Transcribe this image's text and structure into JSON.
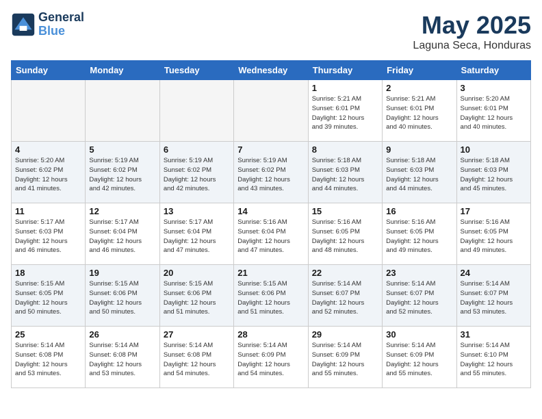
{
  "header": {
    "logo_line1": "General",
    "logo_line2": "Blue",
    "month": "May 2025",
    "location": "Laguna Seca, Honduras"
  },
  "weekdays": [
    "Sunday",
    "Monday",
    "Tuesday",
    "Wednesday",
    "Thursday",
    "Friday",
    "Saturday"
  ],
  "weeks": [
    [
      {
        "day": "",
        "info": "",
        "empty": true
      },
      {
        "day": "",
        "info": "",
        "empty": true
      },
      {
        "day": "",
        "info": "",
        "empty": true
      },
      {
        "day": "",
        "info": "",
        "empty": true
      },
      {
        "day": "1",
        "info": "Sunrise: 5:21 AM\nSunset: 6:01 PM\nDaylight: 12 hours\nand 39 minutes."
      },
      {
        "day": "2",
        "info": "Sunrise: 5:21 AM\nSunset: 6:01 PM\nDaylight: 12 hours\nand 40 minutes."
      },
      {
        "day": "3",
        "info": "Sunrise: 5:20 AM\nSunset: 6:01 PM\nDaylight: 12 hours\nand 40 minutes."
      }
    ],
    [
      {
        "day": "4",
        "info": "Sunrise: 5:20 AM\nSunset: 6:02 PM\nDaylight: 12 hours\nand 41 minutes."
      },
      {
        "day": "5",
        "info": "Sunrise: 5:19 AM\nSunset: 6:02 PM\nDaylight: 12 hours\nand 42 minutes."
      },
      {
        "day": "6",
        "info": "Sunrise: 5:19 AM\nSunset: 6:02 PM\nDaylight: 12 hours\nand 42 minutes."
      },
      {
        "day": "7",
        "info": "Sunrise: 5:19 AM\nSunset: 6:02 PM\nDaylight: 12 hours\nand 43 minutes."
      },
      {
        "day": "8",
        "info": "Sunrise: 5:18 AM\nSunset: 6:03 PM\nDaylight: 12 hours\nand 44 minutes."
      },
      {
        "day": "9",
        "info": "Sunrise: 5:18 AM\nSunset: 6:03 PM\nDaylight: 12 hours\nand 44 minutes."
      },
      {
        "day": "10",
        "info": "Sunrise: 5:18 AM\nSunset: 6:03 PM\nDaylight: 12 hours\nand 45 minutes."
      }
    ],
    [
      {
        "day": "11",
        "info": "Sunrise: 5:17 AM\nSunset: 6:03 PM\nDaylight: 12 hours\nand 46 minutes."
      },
      {
        "day": "12",
        "info": "Sunrise: 5:17 AM\nSunset: 6:04 PM\nDaylight: 12 hours\nand 46 minutes."
      },
      {
        "day": "13",
        "info": "Sunrise: 5:17 AM\nSunset: 6:04 PM\nDaylight: 12 hours\nand 47 minutes."
      },
      {
        "day": "14",
        "info": "Sunrise: 5:16 AM\nSunset: 6:04 PM\nDaylight: 12 hours\nand 47 minutes."
      },
      {
        "day": "15",
        "info": "Sunrise: 5:16 AM\nSunset: 6:05 PM\nDaylight: 12 hours\nand 48 minutes."
      },
      {
        "day": "16",
        "info": "Sunrise: 5:16 AM\nSunset: 6:05 PM\nDaylight: 12 hours\nand 49 minutes."
      },
      {
        "day": "17",
        "info": "Sunrise: 5:16 AM\nSunset: 6:05 PM\nDaylight: 12 hours\nand 49 minutes."
      }
    ],
    [
      {
        "day": "18",
        "info": "Sunrise: 5:15 AM\nSunset: 6:05 PM\nDaylight: 12 hours\nand 50 minutes."
      },
      {
        "day": "19",
        "info": "Sunrise: 5:15 AM\nSunset: 6:06 PM\nDaylight: 12 hours\nand 50 minutes."
      },
      {
        "day": "20",
        "info": "Sunrise: 5:15 AM\nSunset: 6:06 PM\nDaylight: 12 hours\nand 51 minutes."
      },
      {
        "day": "21",
        "info": "Sunrise: 5:15 AM\nSunset: 6:06 PM\nDaylight: 12 hours\nand 51 minutes."
      },
      {
        "day": "22",
        "info": "Sunrise: 5:14 AM\nSunset: 6:07 PM\nDaylight: 12 hours\nand 52 minutes."
      },
      {
        "day": "23",
        "info": "Sunrise: 5:14 AM\nSunset: 6:07 PM\nDaylight: 12 hours\nand 52 minutes."
      },
      {
        "day": "24",
        "info": "Sunrise: 5:14 AM\nSunset: 6:07 PM\nDaylight: 12 hours\nand 53 minutes."
      }
    ],
    [
      {
        "day": "25",
        "info": "Sunrise: 5:14 AM\nSunset: 6:08 PM\nDaylight: 12 hours\nand 53 minutes."
      },
      {
        "day": "26",
        "info": "Sunrise: 5:14 AM\nSunset: 6:08 PM\nDaylight: 12 hours\nand 53 minutes."
      },
      {
        "day": "27",
        "info": "Sunrise: 5:14 AM\nSunset: 6:08 PM\nDaylight: 12 hours\nand 54 minutes."
      },
      {
        "day": "28",
        "info": "Sunrise: 5:14 AM\nSunset: 6:09 PM\nDaylight: 12 hours\nand 54 minutes."
      },
      {
        "day": "29",
        "info": "Sunrise: 5:14 AM\nSunset: 6:09 PM\nDaylight: 12 hours\nand 55 minutes."
      },
      {
        "day": "30",
        "info": "Sunrise: 5:14 AM\nSunset: 6:09 PM\nDaylight: 12 hours\nand 55 minutes."
      },
      {
        "day": "31",
        "info": "Sunrise: 5:14 AM\nSunset: 6:10 PM\nDaylight: 12 hours\nand 55 minutes."
      }
    ]
  ]
}
